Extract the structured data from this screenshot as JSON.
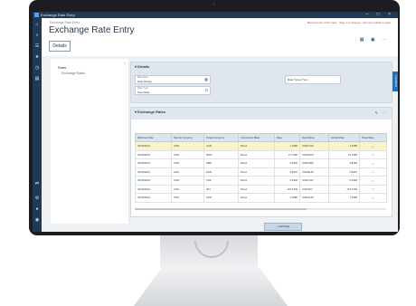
{
  "window": {
    "title": "Exchange Rate Entry",
    "controls": "– □ ×"
  },
  "header": {
    "breadcrumb": "Exchange Rate Entry",
    "title": "Exchange Rate Entry",
    "user_info": "Manual entry of FX rates · Sign in to change · Use the toolbar to save",
    "icons": "▦ ▣ ⋯",
    "details_button": "Details"
  },
  "rail_icons": [
    "⌂",
    "⌕",
    "☰",
    "★",
    "◷",
    "▤",
    "⇄",
    "⚙",
    "●",
    "◉"
  ],
  "nav": {
    "collapse": "«",
    "root": "Rates",
    "child": "Exchange Rates"
  },
  "details_section": {
    "title": "Details",
    "fields": [
      {
        "label": "Rate Date",
        "value": "Date Range",
        "icon": "▦"
      },
      {
        "label": "Rate Type",
        "value": "Spot Rate",
        "icon": "⊡"
      },
      {
        "label": "",
        "value": "Rate Types Type",
        "icon": ""
      }
    ]
  },
  "rates_section": {
    "title": "Exchange Rates",
    "tools": "✎ ⋯",
    "columns": [
      "Effective Date",
      "Source Currency",
      "Target Currency",
      "Conversion Base",
      "Rate",
      "Description",
      "Actual Rate",
      "Fixed Rate"
    ],
    "rows": [
      [
        "03/03/2021",
        "USD",
        "CAD",
        "Direct",
        "1.2480",
        "USD/CAD",
        "1.2480",
        "○"
      ],
      [
        "03/03/2021",
        "USD",
        "MXN",
        "Direct",
        "21.7080",
        "USD/MXN",
        "21.7080",
        "○"
      ],
      [
        "03/03/2021",
        "USD",
        "GBP",
        "Direct",
        "0.8160",
        "USD/GBP",
        "0.8160",
        "○"
      ],
      [
        "03/03/2021",
        "USD",
        "EUR",
        "Direct",
        "0.8467",
        "USD/EUR",
        "0.8467",
        "○"
      ],
      [
        "03/03/2021",
        "USD",
        "CHF",
        "Direct",
        "0.9400",
        "USD/CHF",
        "0.9400",
        "○"
      ],
      [
        "03/03/2021",
        "USD",
        "JPY",
        "Direct",
        "107.5700",
        "USD/JPY",
        "107.5700",
        "○"
      ],
      [
        "03/03/2021",
        "USD",
        "AUD",
        "Direct",
        "1.2980",
        "USD/AUD",
        "1.2980",
        "○"
      ]
    ],
    "selected_row": 0,
    "add_button": "+ Add Rate"
  },
  "side_tab": "Feedback"
}
